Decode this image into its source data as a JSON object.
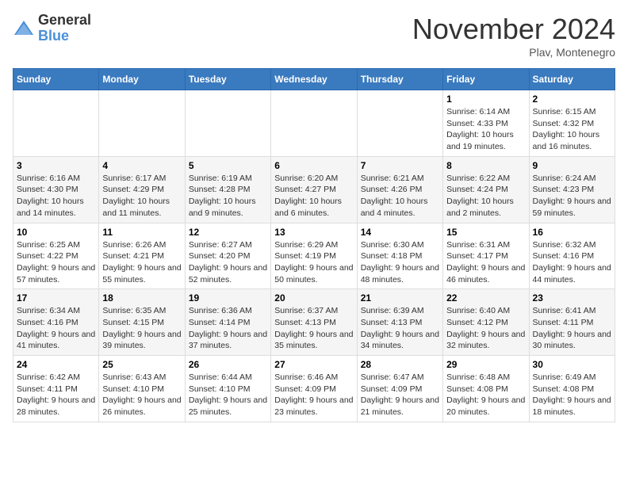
{
  "logo": {
    "general": "General",
    "blue": "Blue"
  },
  "title": "November 2024",
  "location": "Plav, Montenegro",
  "days_of_week": [
    "Sunday",
    "Monday",
    "Tuesday",
    "Wednesday",
    "Thursday",
    "Friday",
    "Saturday"
  ],
  "weeks": [
    [
      {
        "day": "",
        "detail": ""
      },
      {
        "day": "",
        "detail": ""
      },
      {
        "day": "",
        "detail": ""
      },
      {
        "day": "",
        "detail": ""
      },
      {
        "day": "",
        "detail": ""
      },
      {
        "day": "1",
        "detail": "Sunrise: 6:14 AM\nSunset: 4:33 PM\nDaylight: 10 hours and 19 minutes."
      },
      {
        "day": "2",
        "detail": "Sunrise: 6:15 AM\nSunset: 4:32 PM\nDaylight: 10 hours and 16 minutes."
      }
    ],
    [
      {
        "day": "3",
        "detail": "Sunrise: 6:16 AM\nSunset: 4:30 PM\nDaylight: 10 hours and 14 minutes."
      },
      {
        "day": "4",
        "detail": "Sunrise: 6:17 AM\nSunset: 4:29 PM\nDaylight: 10 hours and 11 minutes."
      },
      {
        "day": "5",
        "detail": "Sunrise: 6:19 AM\nSunset: 4:28 PM\nDaylight: 10 hours and 9 minutes."
      },
      {
        "day": "6",
        "detail": "Sunrise: 6:20 AM\nSunset: 4:27 PM\nDaylight: 10 hours and 6 minutes."
      },
      {
        "day": "7",
        "detail": "Sunrise: 6:21 AM\nSunset: 4:26 PM\nDaylight: 10 hours and 4 minutes."
      },
      {
        "day": "8",
        "detail": "Sunrise: 6:22 AM\nSunset: 4:24 PM\nDaylight: 10 hours and 2 minutes."
      },
      {
        "day": "9",
        "detail": "Sunrise: 6:24 AM\nSunset: 4:23 PM\nDaylight: 9 hours and 59 minutes."
      }
    ],
    [
      {
        "day": "10",
        "detail": "Sunrise: 6:25 AM\nSunset: 4:22 PM\nDaylight: 9 hours and 57 minutes."
      },
      {
        "day": "11",
        "detail": "Sunrise: 6:26 AM\nSunset: 4:21 PM\nDaylight: 9 hours and 55 minutes."
      },
      {
        "day": "12",
        "detail": "Sunrise: 6:27 AM\nSunset: 4:20 PM\nDaylight: 9 hours and 52 minutes."
      },
      {
        "day": "13",
        "detail": "Sunrise: 6:29 AM\nSunset: 4:19 PM\nDaylight: 9 hours and 50 minutes."
      },
      {
        "day": "14",
        "detail": "Sunrise: 6:30 AM\nSunset: 4:18 PM\nDaylight: 9 hours and 48 minutes."
      },
      {
        "day": "15",
        "detail": "Sunrise: 6:31 AM\nSunset: 4:17 PM\nDaylight: 9 hours and 46 minutes."
      },
      {
        "day": "16",
        "detail": "Sunrise: 6:32 AM\nSunset: 4:16 PM\nDaylight: 9 hours and 44 minutes."
      }
    ],
    [
      {
        "day": "17",
        "detail": "Sunrise: 6:34 AM\nSunset: 4:16 PM\nDaylight: 9 hours and 41 minutes."
      },
      {
        "day": "18",
        "detail": "Sunrise: 6:35 AM\nSunset: 4:15 PM\nDaylight: 9 hours and 39 minutes."
      },
      {
        "day": "19",
        "detail": "Sunrise: 6:36 AM\nSunset: 4:14 PM\nDaylight: 9 hours and 37 minutes."
      },
      {
        "day": "20",
        "detail": "Sunrise: 6:37 AM\nSunset: 4:13 PM\nDaylight: 9 hours and 35 minutes."
      },
      {
        "day": "21",
        "detail": "Sunrise: 6:39 AM\nSunset: 4:13 PM\nDaylight: 9 hours and 34 minutes."
      },
      {
        "day": "22",
        "detail": "Sunrise: 6:40 AM\nSunset: 4:12 PM\nDaylight: 9 hours and 32 minutes."
      },
      {
        "day": "23",
        "detail": "Sunrise: 6:41 AM\nSunset: 4:11 PM\nDaylight: 9 hours and 30 minutes."
      }
    ],
    [
      {
        "day": "24",
        "detail": "Sunrise: 6:42 AM\nSunset: 4:11 PM\nDaylight: 9 hours and 28 minutes."
      },
      {
        "day": "25",
        "detail": "Sunrise: 6:43 AM\nSunset: 4:10 PM\nDaylight: 9 hours and 26 minutes."
      },
      {
        "day": "26",
        "detail": "Sunrise: 6:44 AM\nSunset: 4:10 PM\nDaylight: 9 hours and 25 minutes."
      },
      {
        "day": "27",
        "detail": "Sunrise: 6:46 AM\nSunset: 4:09 PM\nDaylight: 9 hours and 23 minutes."
      },
      {
        "day": "28",
        "detail": "Sunrise: 6:47 AM\nSunset: 4:09 PM\nDaylight: 9 hours and 21 minutes."
      },
      {
        "day": "29",
        "detail": "Sunrise: 6:48 AM\nSunset: 4:08 PM\nDaylight: 9 hours and 20 minutes."
      },
      {
        "day": "30",
        "detail": "Sunrise: 6:49 AM\nSunset: 4:08 PM\nDaylight: 9 hours and 18 minutes."
      }
    ]
  ]
}
